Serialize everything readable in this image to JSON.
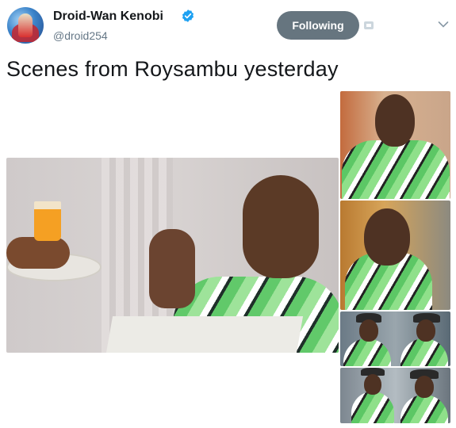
{
  "user": {
    "name": "Droid-Wan Kenobi",
    "handle": "@droid254"
  },
  "follow_button": {
    "label": "Following"
  },
  "tweet": {
    "text": "Scenes from Roysambu yesterday"
  },
  "colors": {
    "follow_bg": "#66757f",
    "verified": "#1da1f2",
    "handle": "#657786"
  },
  "icons": [
    "verified-badge-icon",
    "translate-icon",
    "caret-down-icon"
  ]
}
